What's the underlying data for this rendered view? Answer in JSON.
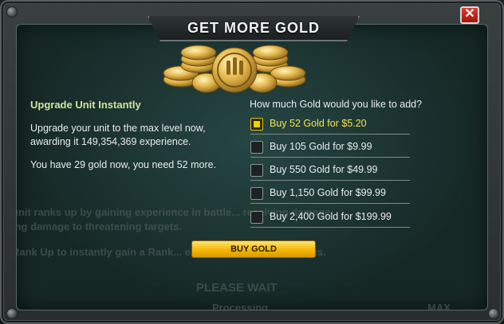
{
  "dialog": {
    "title": "GET MORE GOLD",
    "close_label": "✕",
    "heading": "Upgrade Unit Instantly",
    "description": "Upgrade your unit to the max level now, awarding it 149,354,369 experience.",
    "gold_status": "You have 29 gold now, you need 52 more.",
    "question": "How much Gold would you like to add?",
    "options": [
      {
        "label": "Buy 52 Gold for $5.20",
        "selected": true
      },
      {
        "label": "Buy 105 Gold for $9.99",
        "selected": false
      },
      {
        "label": "Buy 550 Gold for $49.99",
        "selected": false
      },
      {
        "label": "Buy 1,150 Gold for $99.99",
        "selected": false
      },
      {
        "label": "Buy 2,400 Gold for $199.99",
        "selected": false
      }
    ],
    "buy_button": "BUY GOLD"
  },
  "background": {
    "line1": "unit ranks up by gaining experience in battle... receiving damage",
    "line2": "ing damage to threatening targets.",
    "line3": "Rank Up to instantly gain a Rank... else on the bar to view stats.",
    "please_wait": "PLEASE WAIT",
    "processing": "Processing",
    "max_label": "MAX"
  },
  "icons": {
    "close": "close-icon",
    "coins": "gold-coins-icon",
    "checkbox_checked": "checkbox-checked-icon",
    "checkbox_unchecked": "checkbox-unchecked-icon"
  },
  "colors": {
    "heading": "#cfe59a",
    "selected_option": "#f2e44b",
    "button_gold": "#f4b800",
    "close_red": "#c4241a"
  }
}
